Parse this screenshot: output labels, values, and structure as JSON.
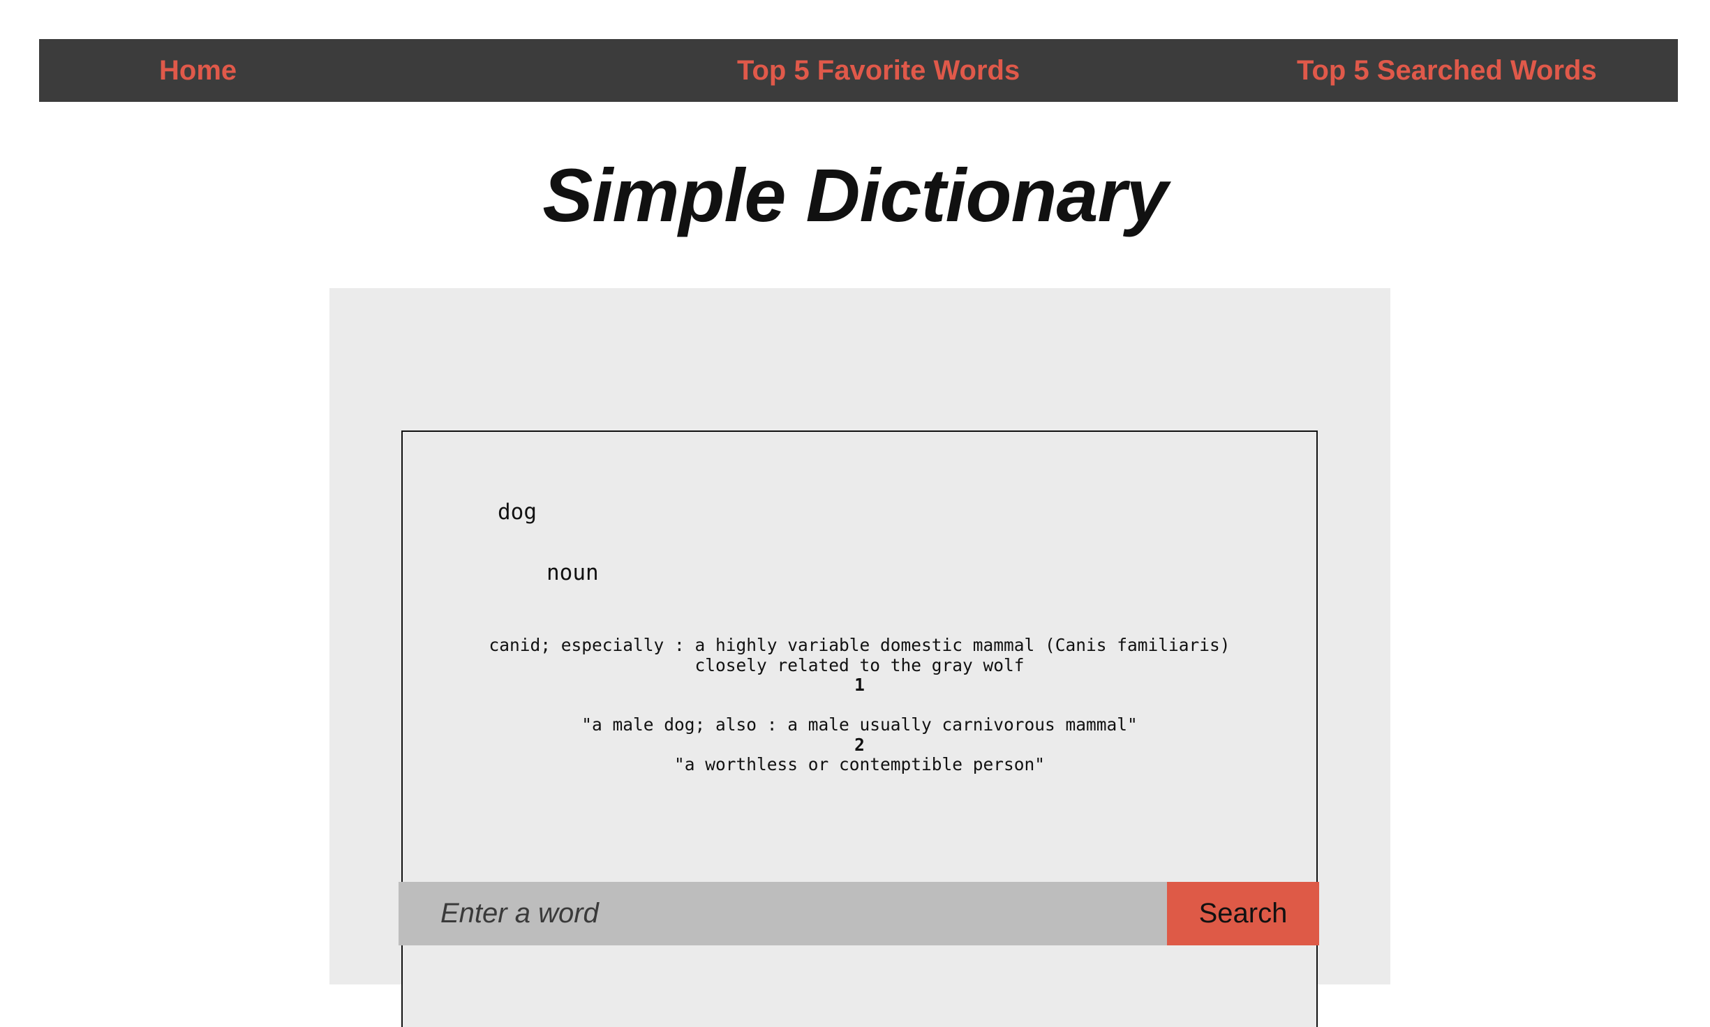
{
  "nav": {
    "home": "Home",
    "favorites": "Top 5 Favorite Words",
    "searched": "Top 5 Searched Words"
  },
  "title": "Simple Dictionary",
  "result": {
    "word": "dog",
    "part_of_speech": "noun",
    "definitions": {
      "intro_line1": "canid; especially : a highly variable domestic mammal (Canis familiaris)",
      "intro_line2": "closely related to the gray wolf",
      "items": [
        {
          "number": "1",
          "text": "\"a male dog; also : a male usually carnivorous mammal\""
        },
        {
          "number": "2",
          "text": "\"a worthless or contemptible person\""
        }
      ]
    }
  },
  "search": {
    "placeholder": "Enter a word",
    "value": "",
    "button_label": "Search"
  },
  "colors": {
    "nav_background": "#3c3c3c",
    "accent": "#e0594a",
    "panel_background": "#ebebeb",
    "input_background": "#bdbdbd",
    "button_background": "#de5a47"
  }
}
